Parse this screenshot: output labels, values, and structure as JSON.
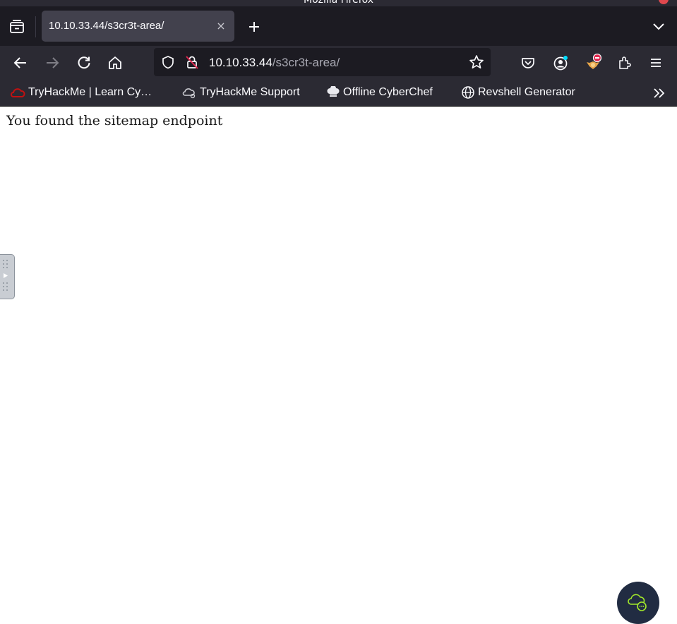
{
  "window": {
    "title": "Mozilla Firefox"
  },
  "tab": {
    "title": "10.10.33.44/s3cr3t-area/",
    "close_glyph": "×"
  },
  "toolbar": {
    "url_host": "10.10.33.44",
    "url_path": "/s3cr3t-area/"
  },
  "bookmarks": [
    {
      "label": "TryHackMe | Learn Cy…",
      "icon": "tryhackme-cloud-icon"
    },
    {
      "label": "TryHackMe Support",
      "icon": "cloud-support-icon"
    },
    {
      "label": "Offline CyberChef",
      "icon": "chef-hat-icon"
    },
    {
      "label": "Revshell Generator",
      "icon": "globe-icon"
    }
  ],
  "page": {
    "text": "You found the sitemap endpoint"
  },
  "colors": {
    "tab_bar": "#1c1b22",
    "toolbar": "#2b2a33",
    "active_tab": "#42414d",
    "thm_red": "#c11111",
    "chat_bubble": "#212c42",
    "chat_icon": "#a3ea2a"
  }
}
